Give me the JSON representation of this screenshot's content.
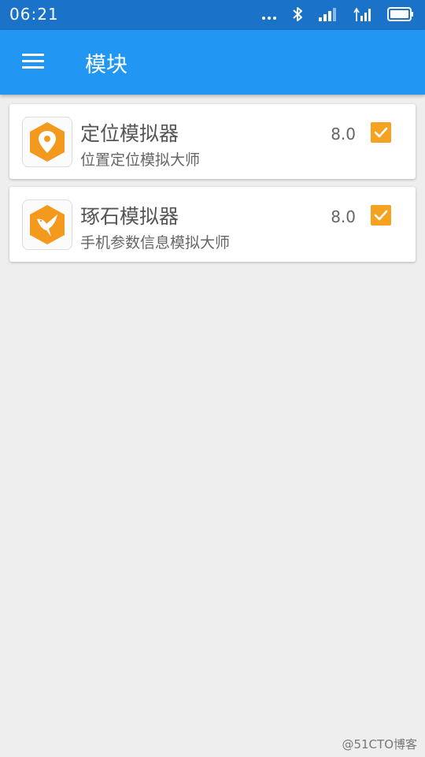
{
  "status_bar": {
    "time": "06:21",
    "icons": [
      "more-dots-icon",
      "bluetooth-icon",
      "signal-icon",
      "signal-data-icon",
      "battery-icon"
    ]
  },
  "app_bar": {
    "title": "模块",
    "menu_icon": "menu-icon"
  },
  "colors": {
    "status_bar": "#1a72c9",
    "app_bar": "#2196f3",
    "accent": "#f4a220",
    "background": "#eeeeee"
  },
  "modules": [
    {
      "title": "定位模拟器",
      "description": "位置定位模拟大师",
      "version": "8.0",
      "enabled": true,
      "icon": "location-pin-icon"
    },
    {
      "title": "琢石模拟器",
      "description": "手机参数信息模拟大师",
      "version": "8.0",
      "enabled": true,
      "icon": "hummingbird-icon"
    }
  ],
  "watermark": "@51CTO博客"
}
